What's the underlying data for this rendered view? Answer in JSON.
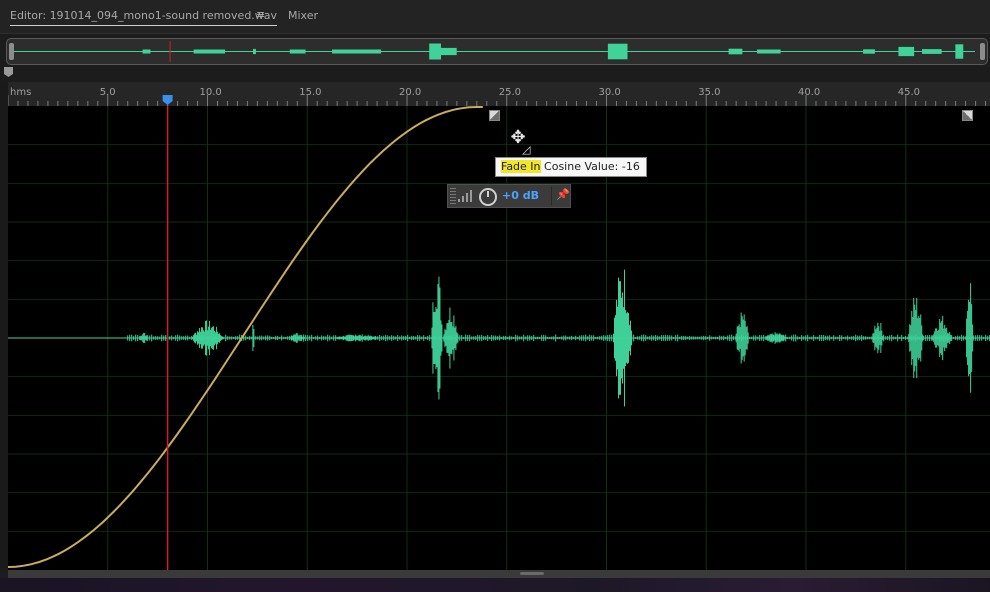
{
  "tabs": {
    "editor_label": "Editor: 191014_094_mono1-sound removed.wav",
    "menu_icon": "≡",
    "mixer_label": "Mixer"
  },
  "ruler": {
    "unit_label": "hms",
    "ticks": [
      {
        "value": 5,
        "label": "5.0"
      },
      {
        "value": 10,
        "label": "10.0"
      },
      {
        "value": 15,
        "label": "15.0"
      },
      {
        "value": 20,
        "label": "20.0"
      },
      {
        "value": 25,
        "label": "25.0"
      },
      {
        "value": 30,
        "label": "30.0"
      },
      {
        "value": 35,
        "label": "35.0"
      },
      {
        "value": 40,
        "label": "40.0"
      },
      {
        "value": 45,
        "label": "45.0"
      }
    ]
  },
  "playhead_time": 8.0,
  "fade": {
    "tooltip_highlight": "Fade In",
    "tooltip_rest": " Cosine Value: -16",
    "type": "Cosine",
    "value": -16
  },
  "hud": {
    "gain_label": "+0 dB",
    "pin_icon": "pin-icon",
    "knob_icon": "volume-knob-icon"
  },
  "colors": {
    "waveform": "#3fd39a",
    "fade_curve": "#c9ad5a",
    "playhead": "#d0201f",
    "playhead_marker": "#3b8fe8",
    "accent_blue": "#4aa3ff"
  }
}
